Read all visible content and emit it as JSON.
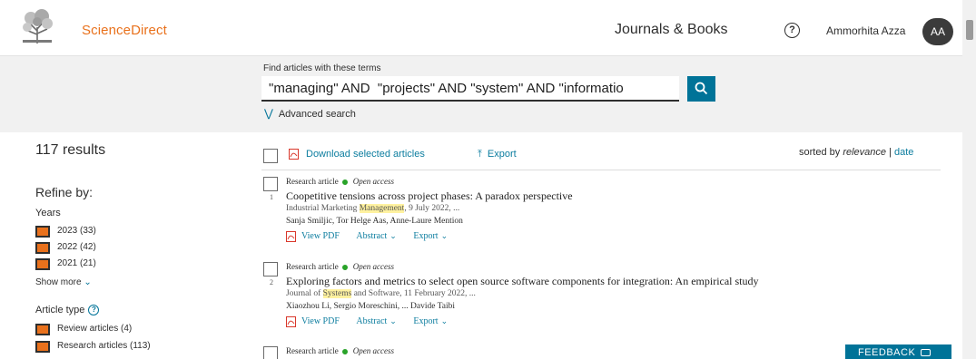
{
  "header": {
    "brand": "ScienceDirect",
    "nav_journals": "Journals & Books",
    "help": "?",
    "user_name": "Ammorhita Azza",
    "avatar_initials": "AA"
  },
  "search": {
    "label": "Find articles with these terms",
    "value": "\"managing\" AND  \"projects\" AND \"system\" AND \"informatio",
    "advanced_label": "Advanced search"
  },
  "sidebar": {
    "results_count": "117 results",
    "refine_label": "Refine by:",
    "years_title": "Years",
    "years": [
      {
        "label": "2023 (33)"
      },
      {
        "label": "2022 (42)"
      },
      {
        "label": "2021 (21)"
      }
    ],
    "show_more": "Show more",
    "article_type_title": "Article type",
    "article_types": [
      {
        "label": "Review articles (4)"
      },
      {
        "label": "Research articles (113)"
      }
    ]
  },
  "toolbar": {
    "download_label": "Download selected articles",
    "export_label": "Export",
    "sort_prefix": "sorted by",
    "sort_active": "relevance",
    "sort_separator": "|",
    "sort_alt": "date"
  },
  "results": [
    {
      "number": "1",
      "type": "Research article",
      "access": "Open access",
      "title": "Coopetitive tensions across project phases: A paradox perspective",
      "journal_pre": "Industrial Marketing ",
      "journal_hl": "Management",
      "journal_post": ", 9 July 2022, ...",
      "authors": "Sanja Smiljic, Tor Helge Aas, Anne-Laure Mention",
      "view_pdf": "View PDF",
      "abstract": "Abstract",
      "export": "Export"
    },
    {
      "number": "2",
      "type": "Research article",
      "access": "Open access",
      "title": "Exploring factors and metrics to select open source software components for integration: An empirical study",
      "journal_pre": "Journal of ",
      "journal_hl": "Systems",
      "journal_post": " and Software, 11 February 2022, ...",
      "authors": "Xiaozhou Li, Sergio Moreschini, ... Davide Taibi",
      "view_pdf": "View PDF",
      "abstract": "Abstract",
      "export": "Export"
    },
    {
      "type": "Research article",
      "access": "Open access"
    }
  ],
  "feedback": "FEEDBACK",
  "colors": {
    "brand_orange": "#e9711c",
    "link_teal": "#0c7d9f",
    "button_teal": "#007398",
    "open_access_green": "#29a329",
    "highlight": "#fff2a0"
  }
}
